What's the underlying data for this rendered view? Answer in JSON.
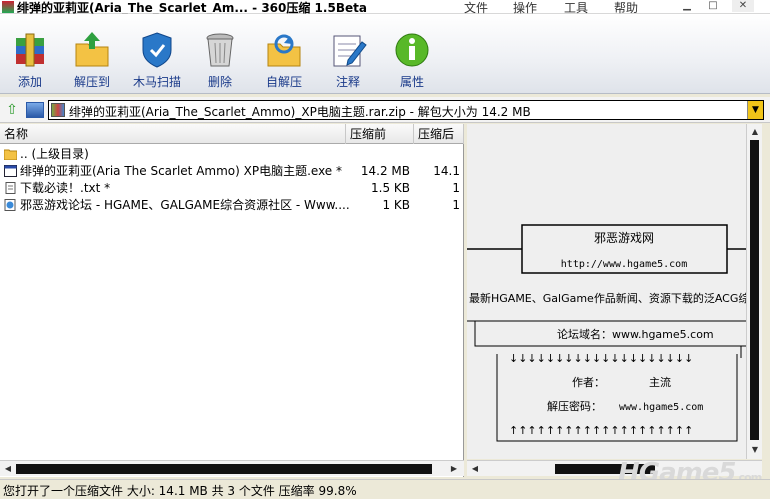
{
  "window": {
    "title": "绯弹的亚莉亚(Aria_The_Scarlet_Am... - 360压缩 1.5Beta",
    "menu": [
      "文件",
      "操作",
      "工具",
      "帮助"
    ]
  },
  "toolbar": {
    "items": [
      {
        "label": "添加",
        "icon": "archive-add-icon"
      },
      {
        "label": "解压到",
        "icon": "extract-folder-icon"
      },
      {
        "label": "木马扫描",
        "icon": "shield-scan-icon"
      },
      {
        "label": "删除",
        "icon": "trash-icon"
      },
      {
        "label": "自解压",
        "icon": "self-extract-icon"
      },
      {
        "label": "注释",
        "icon": "comment-icon"
      },
      {
        "label": "属性",
        "icon": "info-icon"
      }
    ]
  },
  "address": {
    "path": "绯弹的亚莉亚(Aria_The_Scarlet_Ammo)_XP电脑主题.rar.zip - 解包大小为 14.2 MB"
  },
  "file_list": {
    "columns": {
      "name": "名称",
      "size": "压缩前",
      "packed": "压缩后"
    },
    "rows": [
      {
        "name": ".. (上级目录)",
        "size": "",
        "packed": "",
        "icon": "folder-up-icon"
      },
      {
        "name": "绯弹的亚莉亚(Aria The Scarlet Ammo) XP电脑主题.exe *",
        "size": "14.2 MB",
        "packed": "14.1",
        "icon": "exe-file-icon"
      },
      {
        "name": "下载必读！.txt *",
        "size": "1.5 KB",
        "packed": "1",
        "icon": "text-file-icon"
      },
      {
        "name": "邪恶游戏论坛 - HGAME、GALGAME综合资源社区 - Www....",
        "size": "1 KB",
        "packed": "1",
        "icon": "url-file-icon"
      }
    ]
  },
  "preview": {
    "box_title": "邪恶游戏网",
    "box_url": "http://www.hgame5.com",
    "tagline": "最新HGAME、GalGame作品新闻、资源下载的泛ACG综合",
    "domain_line": "论坛域名：www.hgame5.com",
    "author_label": "作者：",
    "author_value": "主流",
    "password_label": "解压密码：",
    "password_value": "www.hgame5.com",
    "down_arrows": "↓↓↓↓↓↓↓↓↓↓↓↓↓↓↓↓↓↓↓↓",
    "up_arrows": "↑↑↑↑↑↑↑↑↑↑↑↑↑↑↑↑↑↑↑↑"
  },
  "status": {
    "text": "您打开了一个压缩文件 大小: 14.1 MB 共 3 个文件 压缩率 99.8%"
  },
  "watermark": {
    "main": "HGame5",
    "sub": ".com"
  }
}
